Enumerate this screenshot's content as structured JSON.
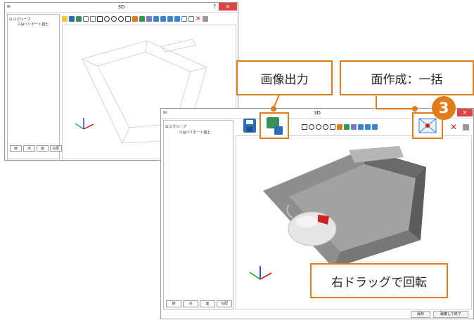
{
  "back_window": {
    "title": "3D",
    "tree": {
      "group": "グループ",
      "item": "ヘリポート盛土"
    },
    "tabs": [
      "線",
      "点",
      "面",
      "勾配"
    ],
    "icons": [
      "folder-icon",
      "save-icon",
      "save-image-icon",
      "undo-icon",
      "redo-icon",
      "zoom-fit-icon",
      "zoom-in-icon",
      "zoom-out-icon",
      "zoom-window-icon",
      "select-icon",
      "pan-icon",
      "rotate-icon",
      "paint-icon",
      "layer-up-icon",
      "layer-down-icon",
      "move-icon",
      "arrow-icon",
      "grid-icon",
      "face-create-icon",
      "delete-icon",
      "tool-icon"
    ]
  },
  "front_window": {
    "title": "3D",
    "tree": {
      "group": "グループ",
      "item": "ヘリポート盛土"
    },
    "tabs": [
      "線",
      "点",
      "面",
      "勾配"
    ],
    "buttons": {
      "save": "保存",
      "close": "破棄して終了"
    }
  },
  "callouts": {
    "save_image": "画像出力",
    "face_create": "面作成：一括",
    "drag": "右ドラッグで回転",
    "step_number": "3"
  },
  "colors": {
    "accent": "#e07c1a",
    "close_button": "#e04343",
    "model_fill": "#8c8c8c",
    "delete_x": "#d02020"
  }
}
